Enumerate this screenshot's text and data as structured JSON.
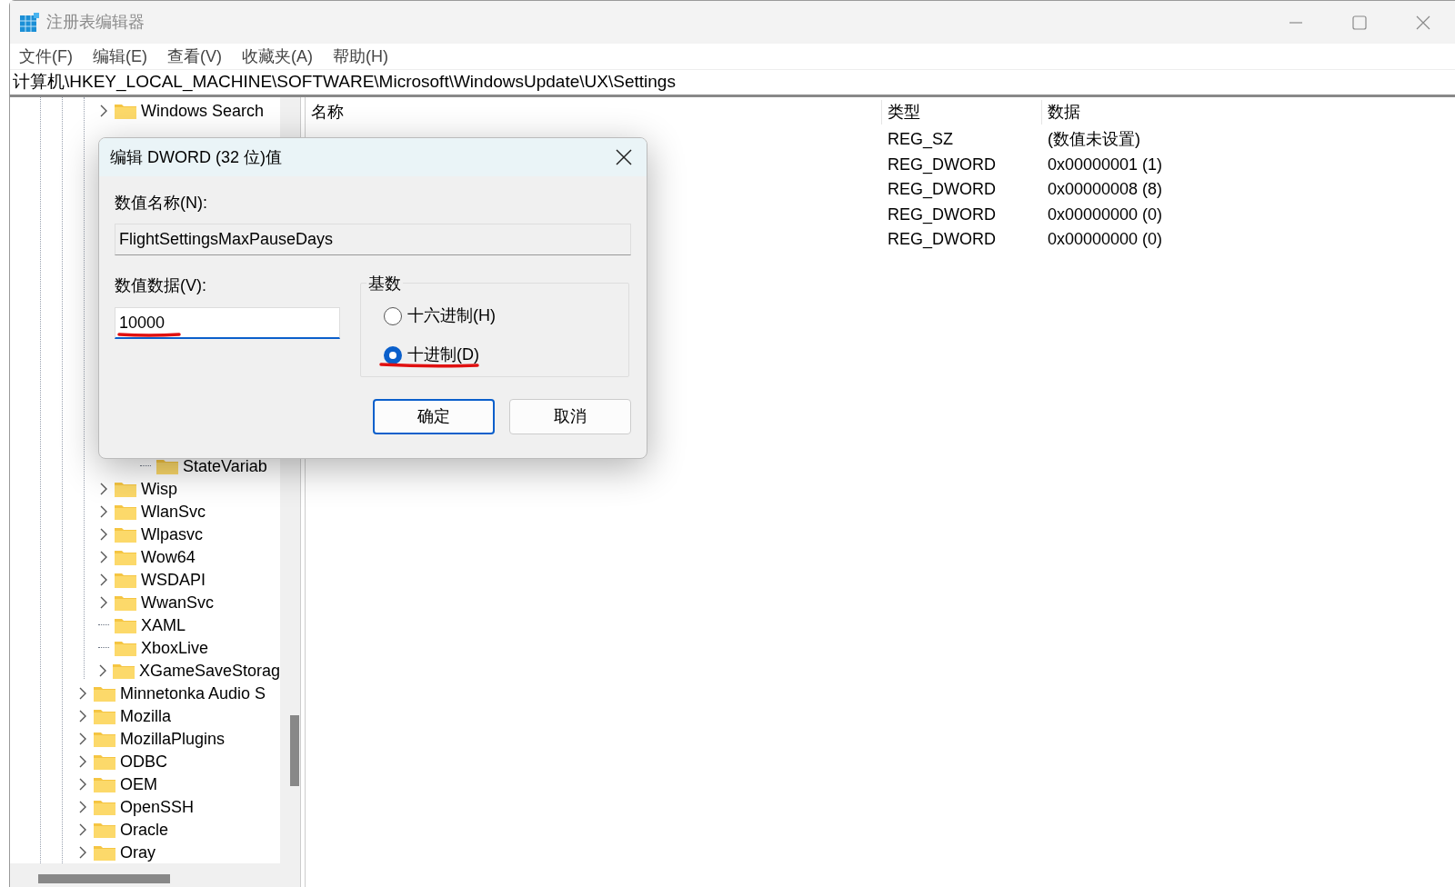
{
  "window": {
    "title": "注册表编辑器"
  },
  "menu": [
    "文件(F)",
    "编辑(E)",
    "查看(V)",
    "收藏夹(A)",
    "帮助(H)"
  ],
  "address_bar": "计算机\\HKEY_LOCAL_MACHINE\\SOFTWARE\\Microsoft\\WindowsUpdate\\UX\\Settings",
  "tree": {
    "branch_above": [
      {
        "label": "Windows Search",
        "expandable": true
      },
      {
        "children": [
          {
            "label": "StateVariab",
            "expandable": false
          }
        ]
      },
      {
        "label": "Wisp",
        "expandable": true
      },
      {
        "label": "WlanSvc",
        "expandable": true
      },
      {
        "label": "Wlpasvc",
        "expandable": true
      },
      {
        "label": "Wow64",
        "expandable": true
      },
      {
        "label": "WSDAPI",
        "expandable": true
      },
      {
        "label": "WwanSvc",
        "expandable": true
      },
      {
        "label": "XAML",
        "expandable": false
      },
      {
        "label": "XboxLive",
        "expandable": false
      },
      {
        "label": "XGameSaveStorag",
        "expandable": true
      }
    ],
    "items": [
      {
        "label": "Minnetonka Audio S",
        "expandable": true
      },
      {
        "label": "Mozilla",
        "expandable": true
      },
      {
        "label": "MozillaPlugins",
        "expandable": true
      },
      {
        "label": "ODBC",
        "expandable": true
      },
      {
        "label": "OEM",
        "expandable": true
      },
      {
        "label": "OpenSSH",
        "expandable": true
      },
      {
        "label": "Oracle",
        "expandable": true
      },
      {
        "label": "Oray",
        "expandable": true
      }
    ]
  },
  "values": {
    "columns": [
      "名称",
      "类型",
      "数据"
    ],
    "rows": [
      {
        "type": "REG_SZ",
        "data": "(数值未设置)"
      },
      {
        "type": "REG_DWORD",
        "data": "0x00000001 (1)"
      },
      {
        "type": "REG_DWORD",
        "data": "0x00000008 (8)"
      },
      {
        "type": "REG_DWORD",
        "data": "0x00000000 (0)"
      },
      {
        "type": "REG_DWORD",
        "data": "0x00000000 (0)"
      }
    ]
  },
  "dialog": {
    "title": "编辑 DWORD (32 位)值",
    "name_label": "数值名称(N):",
    "name_value": "FlightSettingsMaxPauseDays",
    "data_label": "数值数据(V):",
    "data_value": "10000",
    "base": {
      "title": "基数",
      "options": [
        {
          "label": "十六进制(H)",
          "selected": false
        },
        {
          "label": "十进制(D)",
          "selected": true
        }
      ]
    },
    "buttons": [
      {
        "label": "确定",
        "default": true
      },
      {
        "label": "取消",
        "default": false
      }
    ]
  }
}
